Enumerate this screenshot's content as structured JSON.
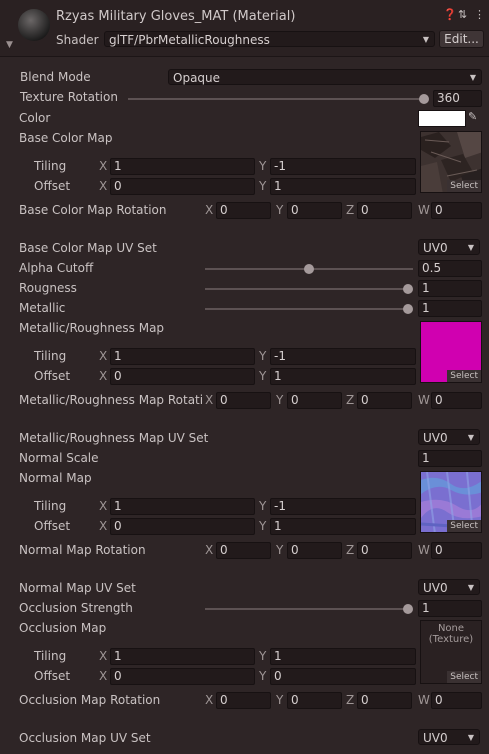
{
  "header": {
    "title": "Rzyas Military Gloves_MAT (Material)",
    "shader_label": "Shader",
    "shader_value": "glTF/PbrMetallicRoughness",
    "edit_label": "Edit...",
    "icons": [
      "help-icon",
      "preset-icon",
      "more-icon"
    ]
  },
  "blend_mode": {
    "label": "Blend Mode",
    "value": "Opaque"
  },
  "texture_rotation": {
    "label": "Texture Rotation",
    "value": "360",
    "fraction": 1.0
  },
  "color": {
    "label": "Color",
    "value_hex": "#ffffff"
  },
  "base_color_map": {
    "label": "Base Color Map",
    "tiling_label": "Tiling",
    "offset_label": "Offset",
    "tiling": {
      "x": "1",
      "y": "-1"
    },
    "offset": {
      "x": "0",
      "y": "1"
    },
    "select": "Select"
  },
  "base_color_map_rotation": {
    "label": "Base Color Map Rotation",
    "x": "0",
    "y": "0",
    "z": "0",
    "w": "0"
  },
  "base_color_map_uv": {
    "label": "Base Color Map UV Set",
    "value": "UV0"
  },
  "alpha_cutoff": {
    "label": "Alpha Cutoff",
    "value": "0.5",
    "fraction": 0.5
  },
  "roughness": {
    "label": "Rougness",
    "value": "1",
    "fraction": 1.0
  },
  "metallic": {
    "label": "Metallic",
    "value": "1",
    "fraction": 1.0
  },
  "metallic_roughness_map": {
    "label": "Metallic/Roughness Map",
    "tiling_label": "Tiling",
    "offset_label": "Offset",
    "tiling": {
      "x": "1",
      "y": "-1"
    },
    "offset": {
      "x": "0",
      "y": "1"
    },
    "select": "Select",
    "color": "#d000b0"
  },
  "metallic_roughness_map_rotation": {
    "label": "Metallic/Roughness Map Rotatio",
    "x": "0",
    "y": "0",
    "z": "0",
    "w": "0"
  },
  "metallic_roughness_map_uv": {
    "label": "Metallic/Roughness Map UV Set",
    "value": "UV0"
  },
  "normal_scale": {
    "label": "Normal Scale",
    "value": "1"
  },
  "normal_map": {
    "label": "Normal Map",
    "tiling_label": "Tiling",
    "offset_label": "Offset",
    "tiling": {
      "x": "1",
      "y": "-1"
    },
    "offset": {
      "x": "0",
      "y": "1"
    },
    "select": "Select"
  },
  "normal_map_rotation": {
    "label": "Normal Map Rotation",
    "x": "0",
    "y": "0",
    "z": "0",
    "w": "0"
  },
  "normal_map_uv": {
    "label": "Normal Map UV Set",
    "value": "UV0"
  },
  "occlusion_strength": {
    "label": "Occlusion Strength",
    "value": "1",
    "fraction": 1.0
  },
  "occlusion_map": {
    "label": "Occlusion Map",
    "tiling_label": "Tiling",
    "offset_label": "Offset",
    "tiling": {
      "x": "1",
      "y": "1"
    },
    "offset": {
      "x": "0",
      "y": "0"
    },
    "none_line1": "None",
    "none_line2": "(Texture)",
    "select": "Select"
  },
  "occlusion_map_rotation": {
    "label": "Occlusion Map Rotation",
    "x": "0",
    "y": "0",
    "z": "0",
    "w": "0"
  },
  "occlusion_map_uv": {
    "label": "Occlusion Map UV Set",
    "value": "UV0"
  },
  "axes": {
    "x": "X",
    "y": "Y",
    "z": "Z",
    "w": "W"
  }
}
